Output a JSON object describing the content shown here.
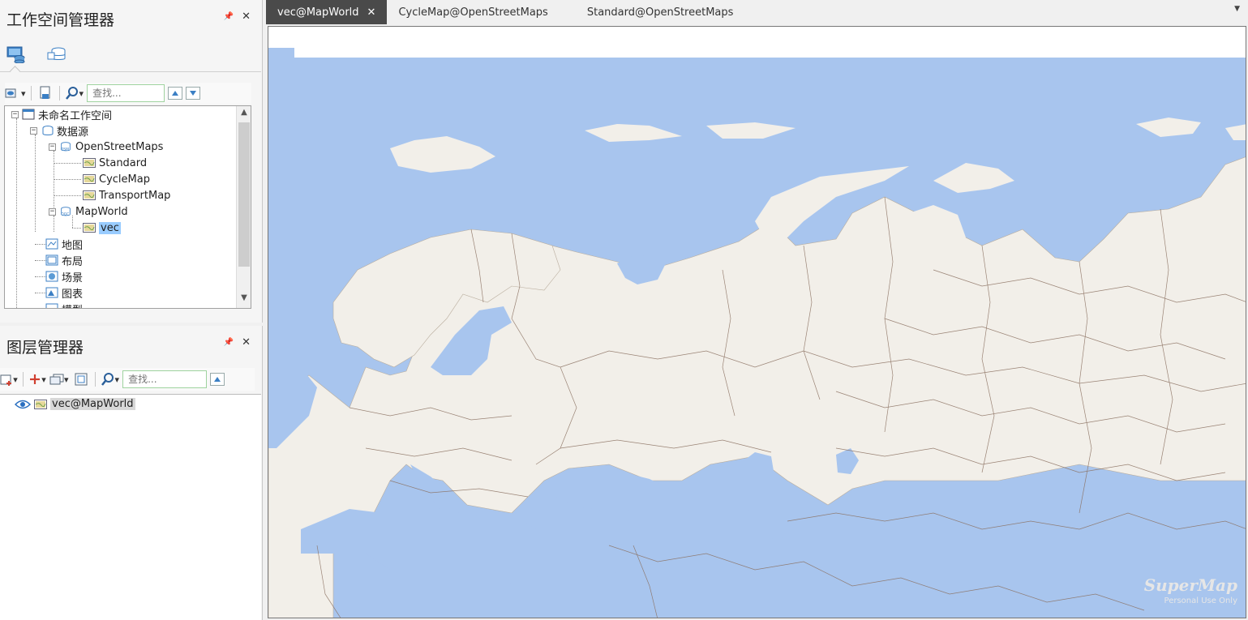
{
  "workspace_manager": {
    "title": "工作空间管理器",
    "search_placeholder": "查找...",
    "tree": {
      "root": "未命名工作空间",
      "datasources": "数据源",
      "osm": "OpenStreetMaps",
      "osm_children": [
        "Standard",
        "CycleMap",
        "TransportMap"
      ],
      "mapworld": "MapWorld",
      "mapworld_children": [
        "vec"
      ],
      "maps": "地图",
      "layouts": "布局",
      "scenes": "场景",
      "charts": "图表",
      "models": "模型"
    }
  },
  "layer_manager": {
    "title": "图层管理器",
    "search_placeholder": "查找...",
    "layers": [
      "vec@MapWorld"
    ]
  },
  "tabs": [
    {
      "label": "vec@MapWorld",
      "active": true
    },
    {
      "label": "CycleMap@OpenStreetMaps",
      "active": false
    },
    {
      "label": "Standard@OpenStreetMaps",
      "active": false
    }
  ],
  "colors": {
    "water": "#a8c5ee",
    "land": "#f2efe9",
    "border": "#8a7060",
    "active_tab": "#4a4a4a",
    "selection": "#99ccff"
  },
  "watermark": {
    "brand": "SuperMap",
    "sub": "Personal Use Only"
  }
}
